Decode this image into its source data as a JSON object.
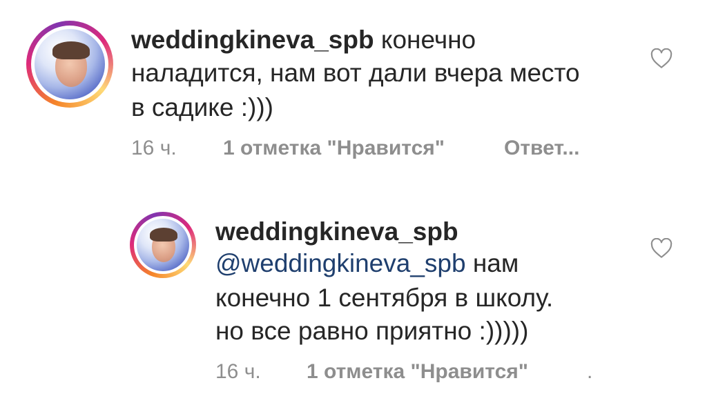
{
  "comments": [
    {
      "username": "weddingkineva_spb",
      "text": " конечно",
      "line2": "наладится, нам вот дали вчера место",
      "line3": "в садике :)))",
      "time": "16 ч.",
      "likes": "1 отметка \"Нравится\"",
      "reply": "Ответ..."
    },
    {
      "username": "weddingkineva_spb",
      "mention": "@weddingkineva_spb",
      "text_after_mention": " нам",
      "line2": "конечно 1 сентября в школу.",
      "line3": "но все равно приятно :)))))",
      "time": "16 ч.",
      "likes": "1 отметка \"Нравится\"",
      "trailing": "."
    }
  ],
  "icons": {
    "like": "heart-outline-icon"
  }
}
